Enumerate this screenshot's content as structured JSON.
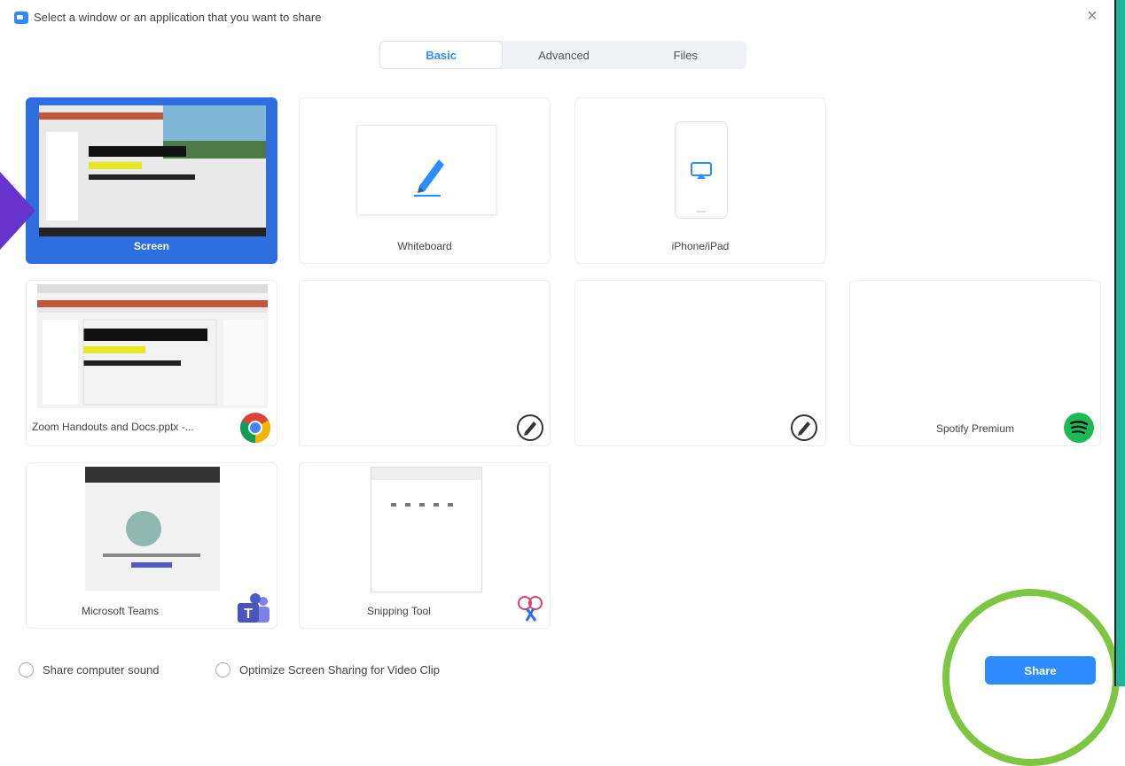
{
  "window": {
    "title": "Select a window or an application that you want to share",
    "close_glyph": "×"
  },
  "tabs": [
    {
      "label": "Basic",
      "active": true
    },
    {
      "label": "Advanced",
      "active": false
    },
    {
      "label": "Files",
      "active": false
    }
  ],
  "tiles": [
    {
      "label": "Screen",
      "selected": true
    },
    {
      "label": "Whiteboard"
    },
    {
      "label": "iPhone/iPad"
    },
    {
      "label": "Zoom Handouts and Docs.pptx -..."
    },
    {
      "label": ""
    },
    {
      "label": ""
    },
    {
      "label": "Spotify Premium"
    },
    {
      "label": "Microsoft Teams"
    },
    {
      "label": "Snipping Tool"
    }
  ],
  "options": {
    "share_sound": "Share computer sound",
    "optimize_video": "Optimize Screen Sharing for Video Clip"
  },
  "actions": {
    "share_label": "Share"
  },
  "colors": {
    "accent": "#2d8cff",
    "selected_tile": "#2d6fe0",
    "annotation_ring": "#7dc642",
    "annotation_pointer": "#6633cc",
    "spotify": "#1db954",
    "teams": "#5059c9"
  }
}
